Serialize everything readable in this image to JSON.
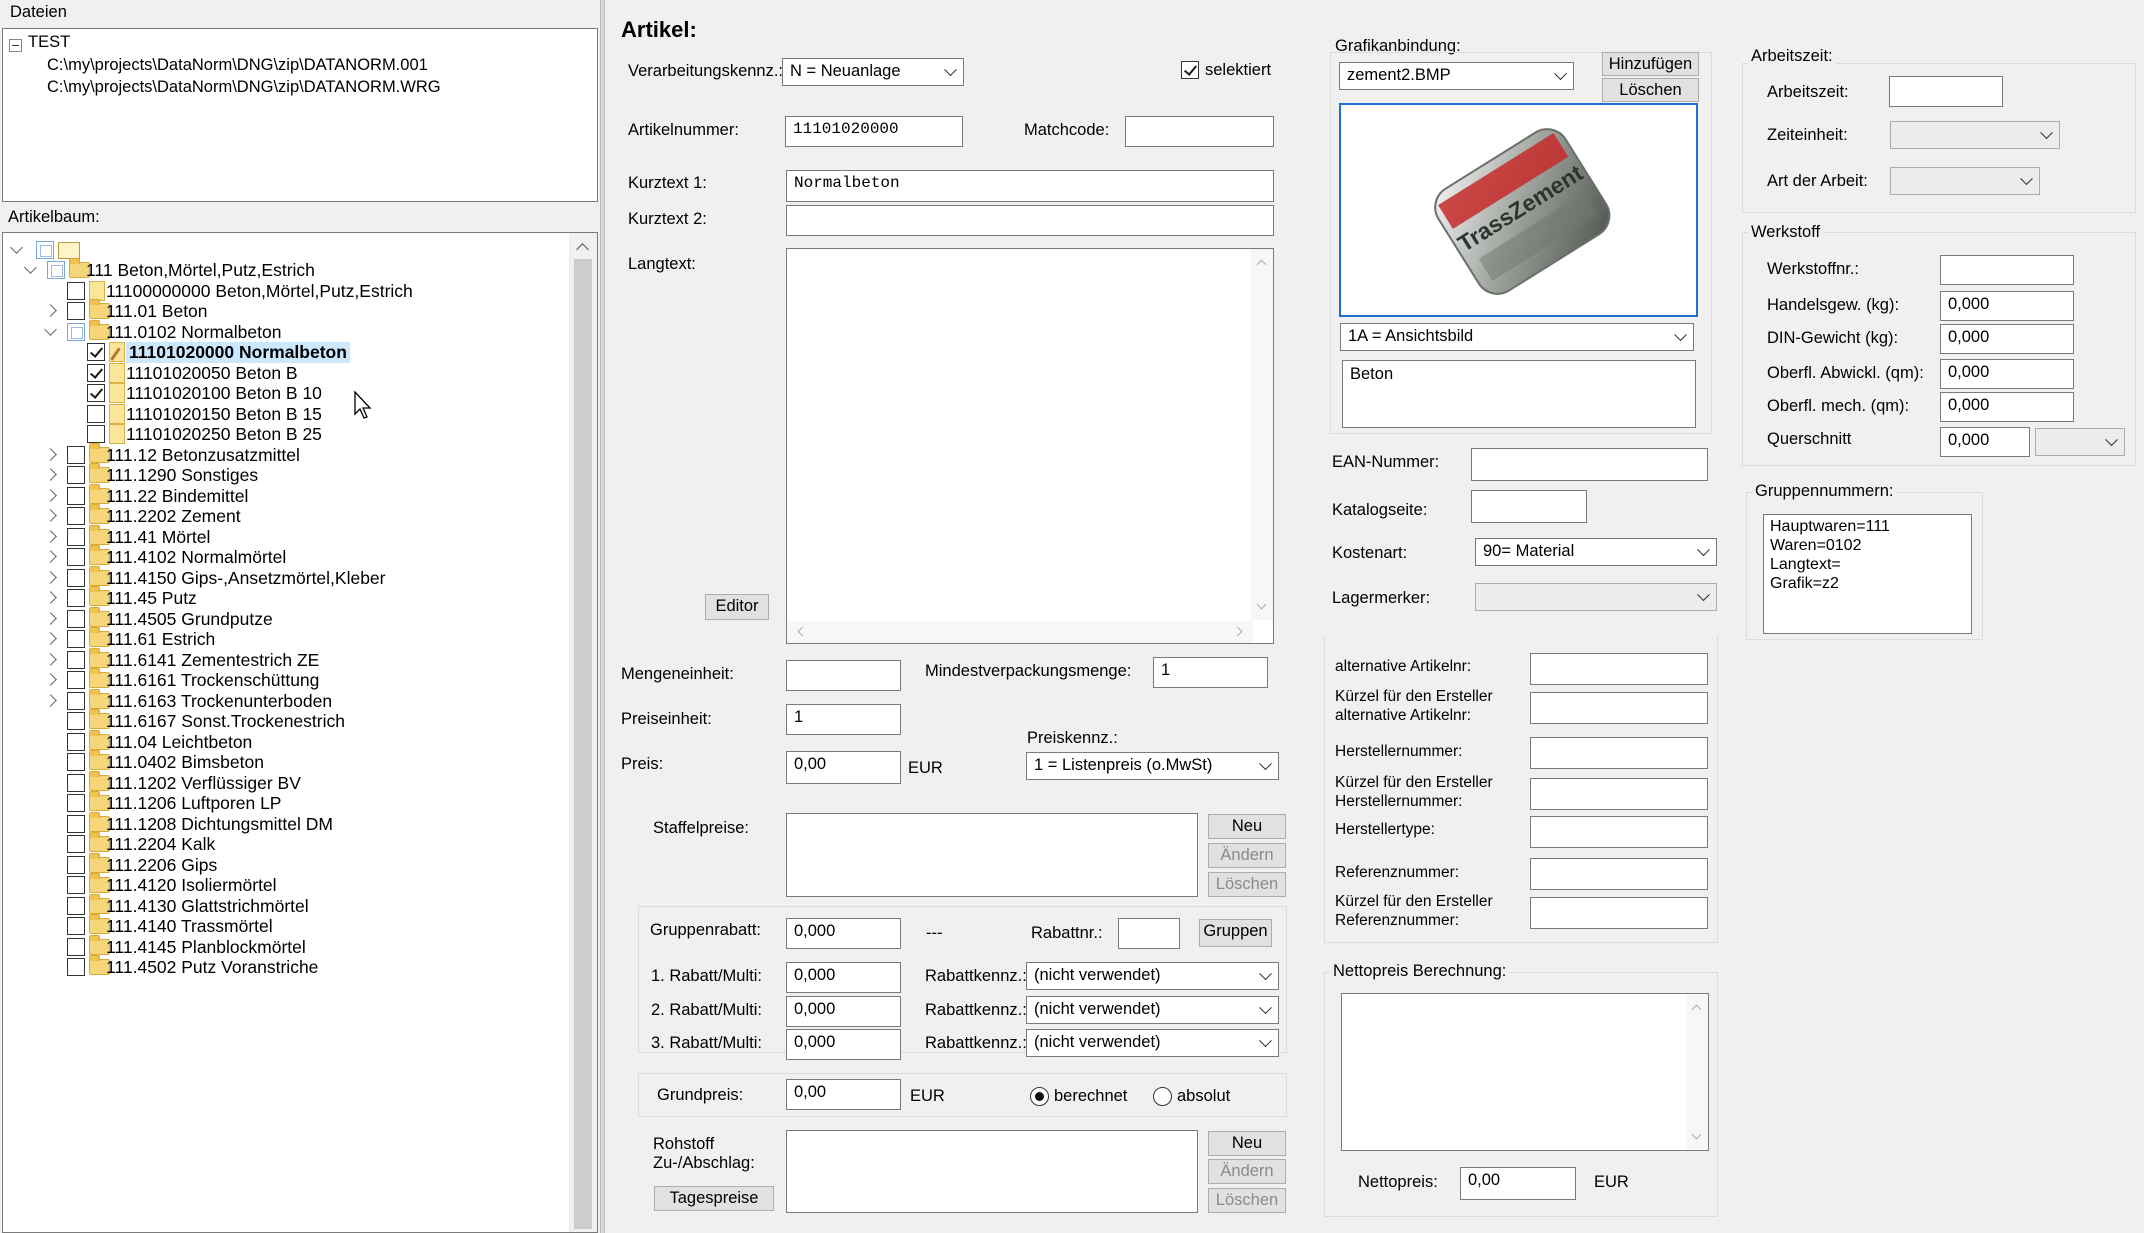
{
  "files_panel": {
    "title": "Dateien",
    "root": "TEST",
    "files": [
      "C:\\my\\projects\\DataNorm\\DNG\\zip\\DATANORM.001",
      "C:\\my\\projects\\DataNorm\\DNG\\zip\\DATANORM.WRG"
    ]
  },
  "tree_panel": {
    "title": "Artikelbaum:",
    "nodes": [
      {
        "label": "111 Beton,Mörtel,Putz,Estrich"
      },
      {
        "label": "11100000000 Beton,Mörtel,Putz,Estrich"
      },
      {
        "label": "111.01 Beton"
      },
      {
        "label": "111.0102 Normalbeton"
      },
      {
        "label": "11101020000 Normalbeton"
      },
      {
        "label": "11101020050 Beton B"
      },
      {
        "label": "11101020100 Beton B 10"
      },
      {
        "label": "11101020150 Beton B 15"
      },
      {
        "label": "11101020250 Beton B 25"
      },
      {
        "label": "111.12 Betonzusatzmittel"
      },
      {
        "label": "111.1290 Sonstiges"
      },
      {
        "label": "111.22 Bindemittel"
      },
      {
        "label": "111.2202 Zement"
      },
      {
        "label": "111.41 Mörtel"
      },
      {
        "label": "111.4102 Normalmörtel"
      },
      {
        "label": "111.4150 Gips-,Ansetzmörtel,Kleber"
      },
      {
        "label": "111.45 Putz"
      },
      {
        "label": "111.4505 Grundputze"
      },
      {
        "label": "111.61 Estrich"
      },
      {
        "label": "111.6141 Zementestrich ZE"
      },
      {
        "label": "111.6161 Trockenschüttung"
      },
      {
        "label": "111.6163 Trockenunterboden"
      },
      {
        "label": "111.6167 Sonst.Trockenestrich"
      },
      {
        "label": "111.04 Leichtbeton"
      },
      {
        "label": "111.0402 Bimsbeton"
      },
      {
        "label": "111.1202 Verflüssiger BV"
      },
      {
        "label": "111.1206 Luftporen LP"
      },
      {
        "label": "111.1208 Dichtungsmittel DM"
      },
      {
        "label": "111.2204 Kalk"
      },
      {
        "label": "111.2206 Gips"
      },
      {
        "label": "111.4120 Isoliermörtel"
      },
      {
        "label": "111.4130 Glattstrichmörtel"
      },
      {
        "label": "111.4140 Trassmörtel"
      },
      {
        "label": "111.4145 Planblockmörtel"
      },
      {
        "label": "111.4502 Putz Voranstriche"
      }
    ]
  },
  "artikel": {
    "heading": "Artikel:",
    "verarbeitung_label": "Verarbeitungskennz.:",
    "verarbeitung_value": "N = Neuanlage",
    "selektiert_label": "selektiert",
    "artikelnummer_label": "Artikelnummer:",
    "artikelnummer_value": "11101020000",
    "matchcode_label": "Matchcode:",
    "matchcode_value": "",
    "kurztext1_label": "Kurztext 1:",
    "kurztext1_value": "Normalbeton",
    "kurztext2_label": "Kurztext 2:",
    "kurztext2_value": "",
    "langtext_label": "Langtext:",
    "editor_button": "Editor",
    "mengeneinheit_label": "Mengeneinheit:",
    "mengeneinheit_value": "",
    "mindest_label": "Mindestverpackungsmenge:",
    "mindest_value": "1",
    "preiseinheit_label": "Preiseinheit:",
    "preiseinheit_value": "1",
    "preis_label": "Preis:",
    "preis_value": "0,00",
    "preis_unit": "EUR",
    "preiskennz_label": "Preiskennz.:",
    "preiskennz_value": "1 = Listenpreis (o.MwSt)",
    "staffel_label": "Staffelpreise:",
    "neu_button": "Neu",
    "aendern_button": "Ändern",
    "loeschen_button": "Löschen",
    "gruppenrabatt_label": "Gruppenrabatt:",
    "gruppenrabatt_value": "0,000",
    "dashes": "---",
    "rabattnr_label": "Rabattnr.:",
    "rabattnr_value": "",
    "gruppen_button": "Gruppen",
    "rabatte": [
      {
        "label": "1. Rabatt/Multi:",
        "value": "0,000",
        "kennz_label": "Rabattkennz.:",
        "kennz_value": "(nicht verwendet)"
      },
      {
        "label": "2. Rabatt/Multi:",
        "value": "0,000",
        "kennz_label": "Rabattkennz.:",
        "kennz_value": "(nicht verwendet)"
      },
      {
        "label": "3. Rabatt/Multi:",
        "value": "0,000",
        "kennz_label": "Rabattkennz.:",
        "kennz_value": "(nicht verwendet)"
      }
    ],
    "grundpreis_label": "Grundpreis:",
    "grundpreis_value": "0,00",
    "grundpreis_unit": "EUR",
    "berechnet_label": "berechnet",
    "absolut_label": "absolut",
    "rohstoff_label1": "Rohstoff",
    "rohstoff_label2": "Zu-/Abschlag:",
    "tagespreise_button": "Tagespreise"
  },
  "grafik": {
    "label": "Grafikanbindung:",
    "file_value": "zement2.BMP",
    "hinzufuegen_button": "Hinzufügen",
    "loeschen_button": "Löschen",
    "image_text": "TrassZement",
    "view_value": "1A = Ansichtsbild",
    "description": "Beton"
  },
  "mid": {
    "ean_label": "EAN-Nummer:",
    "katalog_label": "Katalogseite:",
    "kostenart_label": "Kostenart:",
    "kostenart_value": "90= Material",
    "lagermerker_label": "Lagermerker:",
    "alt_artnr_label": "alternative Artikelnr:",
    "kuerzel_alt_label1": "Kürzel für den Ersteller",
    "kuerzel_alt_label2": "alternative Artikelnr:",
    "hersteller_label": "Herstellernummer:",
    "kuerzel_her_label1": "Kürzel für den Ersteller",
    "kuerzel_her_label2": "Herstellernummer:",
    "herstellertype_label": "Herstellertype:",
    "referenz_label": "Referenznummer:",
    "kuerzel_ref_label1": "Kürzel für den Ersteller",
    "kuerzel_ref_label2": "Referenznummer:",
    "netto_group": "Nettopreis Berechnung:",
    "nettopreis_label": "Nettopreis:",
    "nettopreis_value": "0,00",
    "nettopreis_unit": "EUR"
  },
  "right": {
    "arbeitszeit_group": "Arbeitszeit:",
    "arbeitszeit_label": "Arbeitszeit:",
    "zeiteinheit_label": "Zeiteinheit:",
    "art_label": "Art der Arbeit:",
    "werkstoff_group": "Werkstoff",
    "werkstoffnr_label": "Werkstoffnr.:",
    "handelsgew_label": "Handelsgew. (kg):",
    "handelsgew_value": "0,000",
    "din_label": "DIN-Gewicht (kg):",
    "din_value": "0,000",
    "abwickl_label": "Oberfl. Abwickl. (qm):",
    "abwickl_value": "0,000",
    "mech_label": "Oberfl. mech. (qm):",
    "mech_value": "0,000",
    "querschnitt_label": "Querschnitt",
    "querschnitt_value": "0,000",
    "gruppen_group": "Gruppennummern:",
    "gruppen_lines": [
      "Hauptwaren=111",
      "Waren=0102",
      "Langtext=",
      "Grafik=z2"
    ]
  }
}
